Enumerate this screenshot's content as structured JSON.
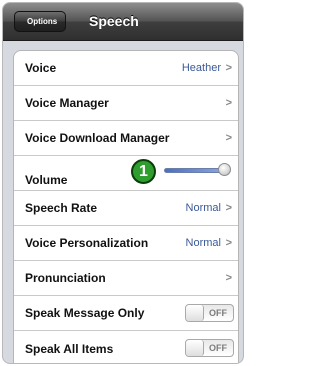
{
  "nav": {
    "back_label": "Options",
    "title": "Speech"
  },
  "rows": [
    {
      "label": "Voice",
      "value": "Heather",
      "chevron": ">"
    },
    {
      "label": "Voice Manager",
      "value": "",
      "chevron": ">"
    },
    {
      "label": "Voice Download Manager",
      "value": "",
      "chevron": ">"
    },
    {
      "label": "Volume"
    },
    {
      "label": "Speech Rate",
      "value": "Normal",
      "chevron": ">"
    },
    {
      "label": "Voice Personalization",
      "value": "Normal",
      "chevron": ">"
    },
    {
      "label": "Pronunciation",
      "value": "",
      "chevron": ">"
    },
    {
      "label": "Speak Message Only",
      "toggle": "OFF"
    },
    {
      "label": "Speak All Items",
      "toggle": "OFF"
    }
  ],
  "volume_level": 0.95,
  "badge": "1",
  "colors": {
    "value_text": "#3b5998",
    "badge": "#2f9e2f"
  }
}
